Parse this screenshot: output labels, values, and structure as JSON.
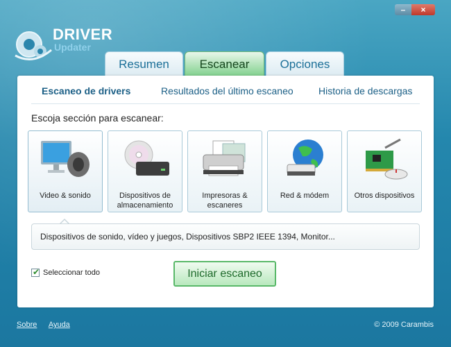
{
  "app": {
    "logo_title": "DRIVER",
    "logo_subtitle": "Updater"
  },
  "window_controls": {
    "minimize": "–",
    "close": "×"
  },
  "tabs": [
    {
      "label": "Resumen",
      "active": false
    },
    {
      "label": "Escanear",
      "active": true
    },
    {
      "label": "Opciones",
      "active": false
    }
  ],
  "subtabs": [
    {
      "label": "Escaneo de drivers",
      "active": true
    },
    {
      "label": "Resultados del último escaneo",
      "active": false
    },
    {
      "label": "Historia de descargas",
      "active": false
    }
  ],
  "section_prompt": "Escoja sección para escanear:",
  "categories": [
    {
      "label": "Video & sonido",
      "icon": "monitor-speaker-icon"
    },
    {
      "label": "Dispositivos de almacenamiento",
      "icon": "disc-drive-icon"
    },
    {
      "label": "Impresoras & escaneres",
      "icon": "printer-icon"
    },
    {
      "label": "Red & módem",
      "icon": "globe-modem-icon"
    },
    {
      "label": "Otros dispositivos",
      "icon": "pci-card-mouse-icon"
    }
  ],
  "description": "Dispositivos de sonido, vídeo y juegos, Dispositivos SBP2 IEEE 1394, Monitor...",
  "select_all": {
    "label": "Seleccionar todo",
    "checked": true
  },
  "start_button": "Iniciar escaneo",
  "footer": {
    "about": "Sobre",
    "help": "Ayuda",
    "copyright": "© 2009 Carambis"
  }
}
